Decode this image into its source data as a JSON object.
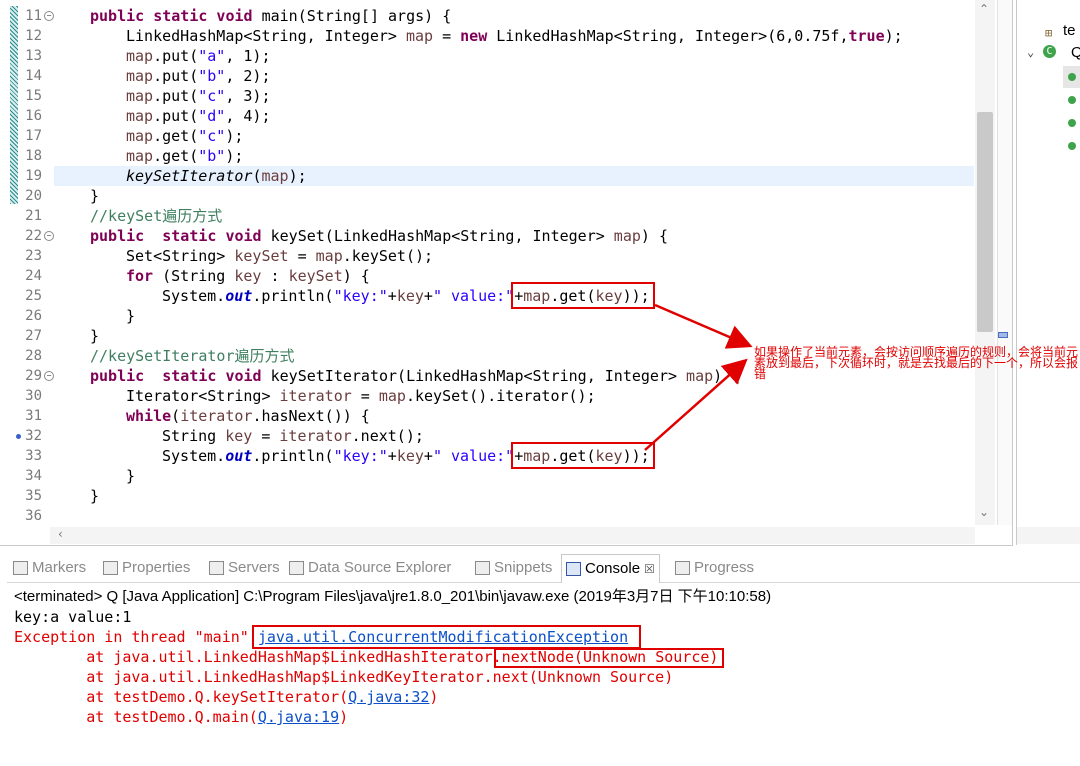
{
  "editor": {
    "lines": [
      {
        "n": "11",
        "html": "<span class=\"kw\">public static void</span> main(String[] args) {",
        "indent": 0
      },
      {
        "n": "12",
        "html": "LinkedHashMap&lt;String, Integer&gt; <span class=\"var\">map</span> = <span class=\"kw\">new</span> LinkedHashMap&lt;String, Integer&gt;(6,0.75f,<span class=\"kw\">true</span>);",
        "indent": 1
      },
      {
        "n": "13",
        "html": "<span class=\"var\">map</span>.put(<span class=\"str\">\"a\"</span>, 1);",
        "indent": 1
      },
      {
        "n": "14",
        "html": "<span class=\"var\">map</span>.put(<span class=\"str\">\"b\"</span>, 2);",
        "indent": 1
      },
      {
        "n": "15",
        "html": "<span class=\"var\">map</span>.put(<span class=\"str\">\"c\"</span>, 3);",
        "indent": 1
      },
      {
        "n": "16",
        "html": "<span class=\"var\">map</span>.put(<span class=\"str\">\"d\"</span>, 4);",
        "indent": 1
      },
      {
        "n": "17",
        "html": "<span class=\"var\">map</span>.get(<span class=\"str\">\"c\"</span>);",
        "indent": 1
      },
      {
        "n": "18",
        "html": "<span class=\"var\">map</span>.get(<span class=\"str\">\"b\"</span>);",
        "indent": 1
      },
      {
        "n": "19",
        "html": "<span class=\"it\">keySetIterator</span>(<span class=\"var\">map</span>);",
        "indent": 1,
        "hl": true
      },
      {
        "n": "20",
        "html": "}",
        "indent": 0
      },
      {
        "n": "21",
        "html": "<span class=\"cm\">//keySet遍历方式</span>",
        "indent": 0
      },
      {
        "n": "22",
        "html": "<span class=\"kw\">public</span>  <span class=\"kw\">static void</span> keySet(LinkedHashMap&lt;String, Integer&gt; <span class=\"var\">map</span>) {",
        "indent": 0
      },
      {
        "n": "23",
        "html": "Set&lt;String&gt; <span class=\"var\">keySet</span> = <span class=\"var\">map</span>.keySet();",
        "indent": 1
      },
      {
        "n": "24",
        "html": "<span class=\"kw\">for</span> (String <span class=\"var\">key</span> : <span class=\"var\">keySet</span>) {",
        "indent": 1
      },
      {
        "n": "25",
        "html": "System.<span class=\"fld\">out</span>.println(<span class=\"str\">\"key:\"</span>+<span class=\"var\">key</span>+<span class=\"str\">\" value:\"</span>+<span class=\"var\">map</span>.get(<span class=\"var\">key</span>));",
        "indent": 2
      },
      {
        "n": "26",
        "html": "}",
        "indent": 1
      },
      {
        "n": "27",
        "html": "}",
        "indent": 0
      },
      {
        "n": "28",
        "html": "<span class=\"cm\">//keySetIterator遍历方式</span>",
        "indent": 0
      },
      {
        "n": "29",
        "html": "<span class=\"kw\">public</span>  <span class=\"kw\">static void</span> keySetIterator(LinkedHashMap&lt;String, Integer&gt; <span class=\"var\">map</span>) {",
        "indent": 0
      },
      {
        "n": "30",
        "html": "Iterator&lt;String&gt; <span class=\"var\">iterator</span> = <span class=\"var\">map</span>.keySet().iterator();",
        "indent": 1
      },
      {
        "n": "31",
        "html": "<span class=\"kw\">while</span>(<span class=\"var\">iterator</span>.hasNext()) {",
        "indent": 1
      },
      {
        "n": "32",
        "html": "String <span class=\"var\">key</span> = <span class=\"var\">iterator</span>.next();",
        "indent": 2
      },
      {
        "n": "33",
        "html": "System.<span class=\"fld\">out</span>.println(<span class=\"str\">\"key:\"</span>+<span class=\"var\">key</span>+<span class=\"str\">\" value:\"</span>+<span class=\"var\">map</span>.get(<span class=\"var\">key</span>));",
        "indent": 2
      },
      {
        "n": "34",
        "html": "}",
        "indent": 1
      },
      {
        "n": "35",
        "html": "}",
        "indent": 0
      },
      {
        "n": "36",
        "html": "",
        "indent": 0
      }
    ]
  },
  "annotation": {
    "note": "如果操作了当前元素，会按访问顺序遍历的规则，会将当前元素放到最后，下次循环时，就是去找最后的下一个，所以会报错"
  },
  "tabs": [
    {
      "label": "Markers"
    },
    {
      "label": "Properties"
    },
    {
      "label": "Servers"
    },
    {
      "label": "Data Source Explorer"
    },
    {
      "label": "Snippets"
    },
    {
      "label": "Console",
      "close": "☒"
    },
    {
      "label": "Progress"
    }
  ],
  "outline": {
    "item1": "te",
    "item2": "Q"
  },
  "console": {
    "title": "<terminated> Q [Java Application] C:\\Program Files\\java\\jre1.8.0_201\\bin\\javaw.exe (2019年3月7日 下午10:10:58)",
    "out1": "key:a value:1",
    "exc_prefix": "Exception in thread \"main\" ",
    "exc_link": "java.util.ConcurrentModificationException",
    "st1_prefix": "        at java.util.LinkedHashMap$LinkedHashIterator.",
    "st1_box": "nextNode(Unknown Source)",
    "st2": "        at java.util.LinkedHashMap$LinkedKeyIterator.next(Unknown Source)",
    "st3_prefix": "        at testDemo.Q.keySetIterator(",
    "st3_link": "Q.java:32",
    "st3_suffix": ")",
    "st4_prefix": "        at testDemo.Q.main(",
    "st4_link": "Q.java:19",
    "st4_suffix": ")"
  },
  "colors": {
    "error": "#e00000",
    "keyword": "#7f0055",
    "string": "#2a00ff",
    "comment": "#3f7f5f"
  }
}
